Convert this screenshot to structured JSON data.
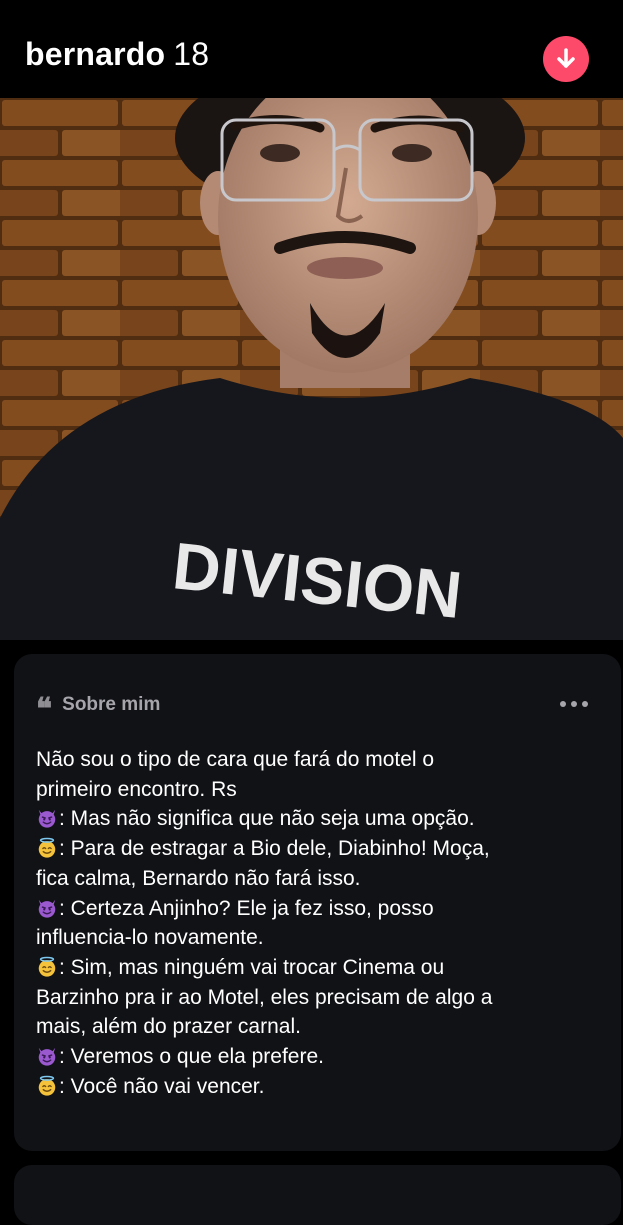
{
  "profile": {
    "name": "bernardo",
    "age": "18"
  },
  "photo": {
    "shirt_text": "DIVISION"
  },
  "about": {
    "title": "Sobre mim",
    "lines": [
      {
        "emoji": "",
        "text": "Não sou o tipo de cara que fará do motel o"
      },
      {
        "emoji": "",
        "text": "primeiro encontro. Rs"
      },
      {
        "emoji": "devil",
        "text": ": Mas não significa que não seja uma opção."
      },
      {
        "emoji": "angel",
        "text": ": Para de estragar a Bio dele, Diabinho! Moça,"
      },
      {
        "emoji": "",
        "text": "fica calma, Bernardo não fará isso."
      },
      {
        "emoji": "devil",
        "text": ": Certeza Anjinho? Ele ja fez isso, posso"
      },
      {
        "emoji": "",
        "text": "influencia-lo novamente."
      },
      {
        "emoji": "angel",
        "text": ": Sim, mas ninguém vai trocar Cinema ou"
      },
      {
        "emoji": "",
        "text": "Barzinho pra ir ao Motel, eles precisam de algo a"
      },
      {
        "emoji": "",
        "text": "mais, além do prazer carnal."
      },
      {
        "emoji": "devil",
        "text": ": Veremos o que ela prefere."
      },
      {
        "emoji": "angel",
        "text": ": Você não vai vencer."
      }
    ]
  },
  "colors": {
    "accent": "#fe4a6a",
    "background": "#000000",
    "card": "#111216",
    "muted_text": "#a5a5ab"
  },
  "icons": {
    "collapse": "arrow-down-icon",
    "quote": "quote-icon",
    "more": "more-options-icon",
    "devil_emoji": "smiling-devil-emoji",
    "angel_emoji": "smiling-angel-emoji"
  }
}
